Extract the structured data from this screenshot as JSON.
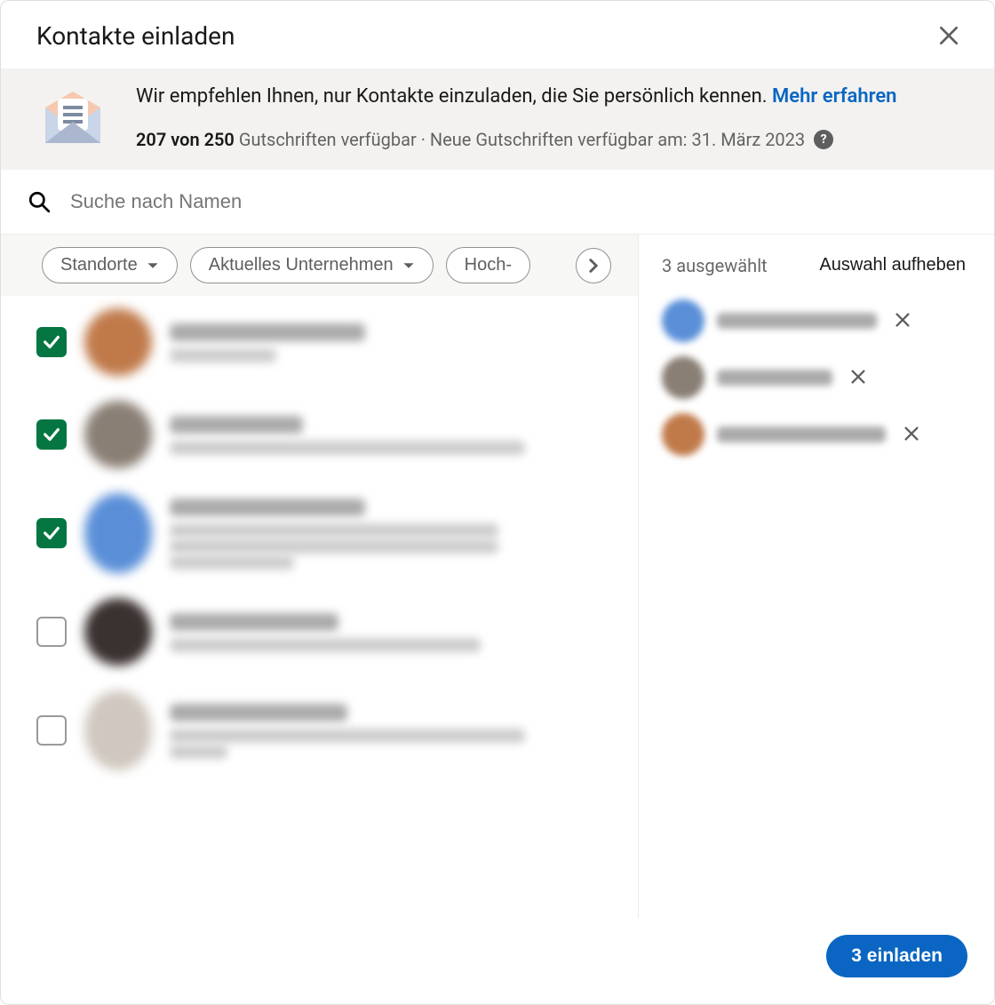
{
  "header": {
    "title": "Kontakte einladen"
  },
  "banner": {
    "text_prefix": "Wir empfehlen Ihnen, nur Kontakte einzuladen, die Sie persönlich kennen. ",
    "link": "Mehr erfahren",
    "credits_strong": "207 von 250",
    "credits_rest": " Gutschriften verfügbar · Neue Gutschriften verfügbar am: 31. März 2023"
  },
  "search": {
    "placeholder": "Suche nach Namen"
  },
  "filters": {
    "locations": "Standorte",
    "company": "Aktuelles Unternehmen",
    "school": "Hoch-"
  },
  "contacts": [
    {
      "checked": true,
      "name_w": 220,
      "subs": [
        120
      ],
      "avatar": "#c07a4a"
    },
    {
      "checked": true,
      "name_w": 150,
      "subs": [
        400
      ],
      "avatar": "#8a7f75"
    },
    {
      "checked": true,
      "name_w": 220,
      "subs": [
        370,
        370,
        140
      ],
      "avatar": "#5a8fd8"
    },
    {
      "checked": false,
      "name_w": 190,
      "subs": [
        350
      ],
      "avatar": "#3a3230"
    },
    {
      "checked": false,
      "name_w": 200,
      "subs": [
        400,
        65
      ],
      "avatar": "#d0c8c0"
    }
  ],
  "selection": {
    "count_label": "3 ausgewählt",
    "clear_label": "Auswahl aufheben",
    "items": [
      {
        "name_w": 180,
        "avatar": "#5a8fd8"
      },
      {
        "name_w": 130,
        "avatar": "#8a7f75"
      },
      {
        "name_w": 190,
        "avatar": "#c07a4a"
      }
    ]
  },
  "footer": {
    "invite_label": "3 einladen"
  }
}
